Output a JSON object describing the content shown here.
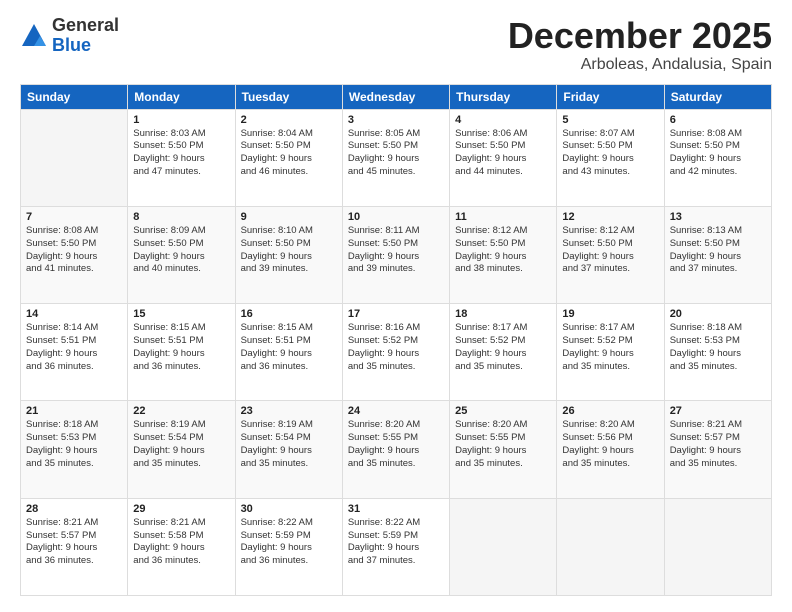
{
  "header": {
    "logo_general": "General",
    "logo_blue": "Blue",
    "month_title": "December 2025",
    "location": "Arboleas, Andalusia, Spain"
  },
  "weekdays": [
    "Sunday",
    "Monday",
    "Tuesday",
    "Wednesday",
    "Thursday",
    "Friday",
    "Saturday"
  ],
  "weeks": [
    [
      {
        "day": "",
        "info": ""
      },
      {
        "day": "1",
        "info": "Sunrise: 8:03 AM\nSunset: 5:50 PM\nDaylight: 9 hours\nand 47 minutes."
      },
      {
        "day": "2",
        "info": "Sunrise: 8:04 AM\nSunset: 5:50 PM\nDaylight: 9 hours\nand 46 minutes."
      },
      {
        "day": "3",
        "info": "Sunrise: 8:05 AM\nSunset: 5:50 PM\nDaylight: 9 hours\nand 45 minutes."
      },
      {
        "day": "4",
        "info": "Sunrise: 8:06 AM\nSunset: 5:50 PM\nDaylight: 9 hours\nand 44 minutes."
      },
      {
        "day": "5",
        "info": "Sunrise: 8:07 AM\nSunset: 5:50 PM\nDaylight: 9 hours\nand 43 minutes."
      },
      {
        "day": "6",
        "info": "Sunrise: 8:08 AM\nSunset: 5:50 PM\nDaylight: 9 hours\nand 42 minutes."
      }
    ],
    [
      {
        "day": "7",
        "info": "Sunrise: 8:08 AM\nSunset: 5:50 PM\nDaylight: 9 hours\nand 41 minutes."
      },
      {
        "day": "8",
        "info": "Sunrise: 8:09 AM\nSunset: 5:50 PM\nDaylight: 9 hours\nand 40 minutes."
      },
      {
        "day": "9",
        "info": "Sunrise: 8:10 AM\nSunset: 5:50 PM\nDaylight: 9 hours\nand 39 minutes."
      },
      {
        "day": "10",
        "info": "Sunrise: 8:11 AM\nSunset: 5:50 PM\nDaylight: 9 hours\nand 39 minutes."
      },
      {
        "day": "11",
        "info": "Sunrise: 8:12 AM\nSunset: 5:50 PM\nDaylight: 9 hours\nand 38 minutes."
      },
      {
        "day": "12",
        "info": "Sunrise: 8:12 AM\nSunset: 5:50 PM\nDaylight: 9 hours\nand 37 minutes."
      },
      {
        "day": "13",
        "info": "Sunrise: 8:13 AM\nSunset: 5:50 PM\nDaylight: 9 hours\nand 37 minutes."
      }
    ],
    [
      {
        "day": "14",
        "info": "Sunrise: 8:14 AM\nSunset: 5:51 PM\nDaylight: 9 hours\nand 36 minutes."
      },
      {
        "day": "15",
        "info": "Sunrise: 8:15 AM\nSunset: 5:51 PM\nDaylight: 9 hours\nand 36 minutes."
      },
      {
        "day": "16",
        "info": "Sunrise: 8:15 AM\nSunset: 5:51 PM\nDaylight: 9 hours\nand 36 minutes."
      },
      {
        "day": "17",
        "info": "Sunrise: 8:16 AM\nSunset: 5:52 PM\nDaylight: 9 hours\nand 35 minutes."
      },
      {
        "day": "18",
        "info": "Sunrise: 8:17 AM\nSunset: 5:52 PM\nDaylight: 9 hours\nand 35 minutes."
      },
      {
        "day": "19",
        "info": "Sunrise: 8:17 AM\nSunset: 5:52 PM\nDaylight: 9 hours\nand 35 minutes."
      },
      {
        "day": "20",
        "info": "Sunrise: 8:18 AM\nSunset: 5:53 PM\nDaylight: 9 hours\nand 35 minutes."
      }
    ],
    [
      {
        "day": "21",
        "info": "Sunrise: 8:18 AM\nSunset: 5:53 PM\nDaylight: 9 hours\nand 35 minutes."
      },
      {
        "day": "22",
        "info": "Sunrise: 8:19 AM\nSunset: 5:54 PM\nDaylight: 9 hours\nand 35 minutes."
      },
      {
        "day": "23",
        "info": "Sunrise: 8:19 AM\nSunset: 5:54 PM\nDaylight: 9 hours\nand 35 minutes."
      },
      {
        "day": "24",
        "info": "Sunrise: 8:20 AM\nSunset: 5:55 PM\nDaylight: 9 hours\nand 35 minutes."
      },
      {
        "day": "25",
        "info": "Sunrise: 8:20 AM\nSunset: 5:55 PM\nDaylight: 9 hours\nand 35 minutes."
      },
      {
        "day": "26",
        "info": "Sunrise: 8:20 AM\nSunset: 5:56 PM\nDaylight: 9 hours\nand 35 minutes."
      },
      {
        "day": "27",
        "info": "Sunrise: 8:21 AM\nSunset: 5:57 PM\nDaylight: 9 hours\nand 35 minutes."
      }
    ],
    [
      {
        "day": "28",
        "info": "Sunrise: 8:21 AM\nSunset: 5:57 PM\nDaylight: 9 hours\nand 36 minutes."
      },
      {
        "day": "29",
        "info": "Sunrise: 8:21 AM\nSunset: 5:58 PM\nDaylight: 9 hours\nand 36 minutes."
      },
      {
        "day": "30",
        "info": "Sunrise: 8:22 AM\nSunset: 5:59 PM\nDaylight: 9 hours\nand 36 minutes."
      },
      {
        "day": "31",
        "info": "Sunrise: 8:22 AM\nSunset: 5:59 PM\nDaylight: 9 hours\nand 37 minutes."
      },
      {
        "day": "",
        "info": ""
      },
      {
        "day": "",
        "info": ""
      },
      {
        "day": "",
        "info": ""
      }
    ]
  ]
}
